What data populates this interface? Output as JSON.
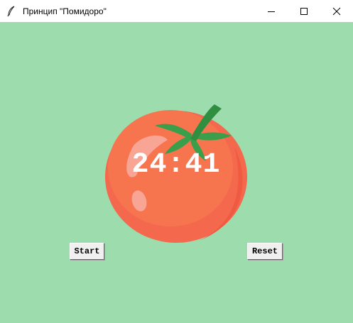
{
  "window": {
    "title": "Принцип \"Помидоро\"",
    "controls": [
      "minimize-icon",
      "maximize-icon",
      "close-icon"
    ]
  },
  "timer": {
    "display": "24:41"
  },
  "buttons": {
    "start_label": "Start",
    "reset_label": "Reset"
  },
  "colors": {
    "background": "#9ddcad",
    "tomato": "#f4694e",
    "leaves": "#3a9e4a",
    "timer_text": "#ffffff"
  }
}
